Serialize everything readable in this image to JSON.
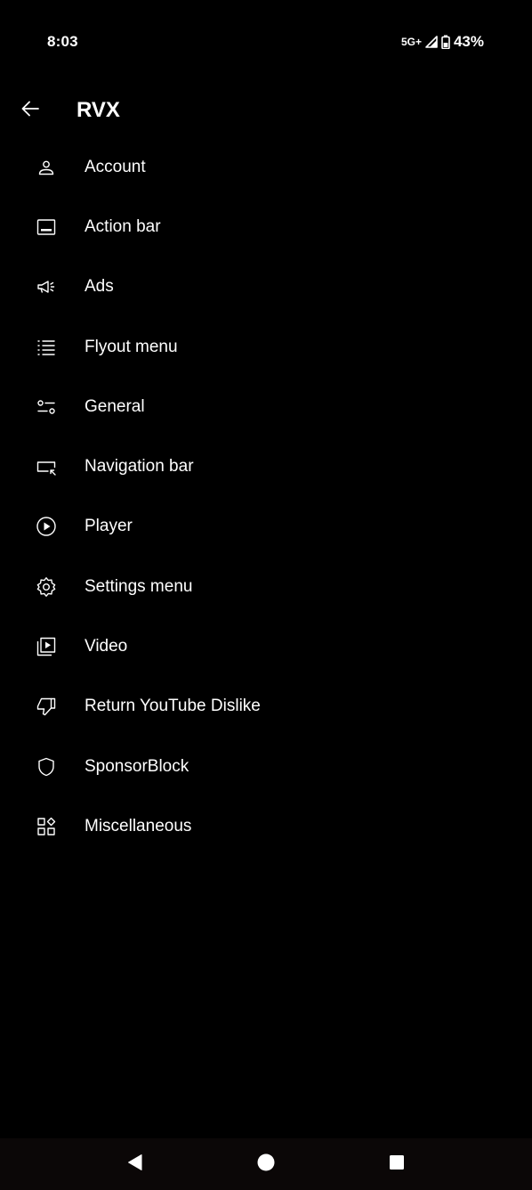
{
  "status_bar": {
    "time": "8:03",
    "network": "5G+",
    "battery": "43%",
    "icons": [
      "signal-icon",
      "battery-icon"
    ]
  },
  "header": {
    "title": "RVX",
    "back_icon": "arrow-back-icon"
  },
  "menu": {
    "items": [
      {
        "label": "Account",
        "icon": "person-icon"
      },
      {
        "label": "Action bar",
        "icon": "action-bar-icon"
      },
      {
        "label": "Ads",
        "icon": "megaphone-icon"
      },
      {
        "label": "Flyout menu",
        "icon": "list-icon"
      },
      {
        "label": "General",
        "icon": "tune-icon"
      },
      {
        "label": "Navigation bar",
        "icon": "navigation-bar-icon"
      },
      {
        "label": "Player",
        "icon": "play-circle-icon"
      },
      {
        "label": "Settings menu",
        "icon": "gear-icon"
      },
      {
        "label": "Video",
        "icon": "video-library-icon"
      },
      {
        "label": "Return YouTube Dislike",
        "icon": "thumb-down-icon"
      },
      {
        "label": "SponsorBlock",
        "icon": "shield-icon"
      },
      {
        "label": "Miscellaneous",
        "icon": "widgets-icon"
      }
    ]
  },
  "system_nav": {
    "icons": [
      "back-triangle-icon",
      "home-circle-icon",
      "recents-square-icon"
    ]
  },
  "colors": {
    "background": "#000000",
    "text": "#ffffff",
    "nav_bar": "#0b0707"
  }
}
